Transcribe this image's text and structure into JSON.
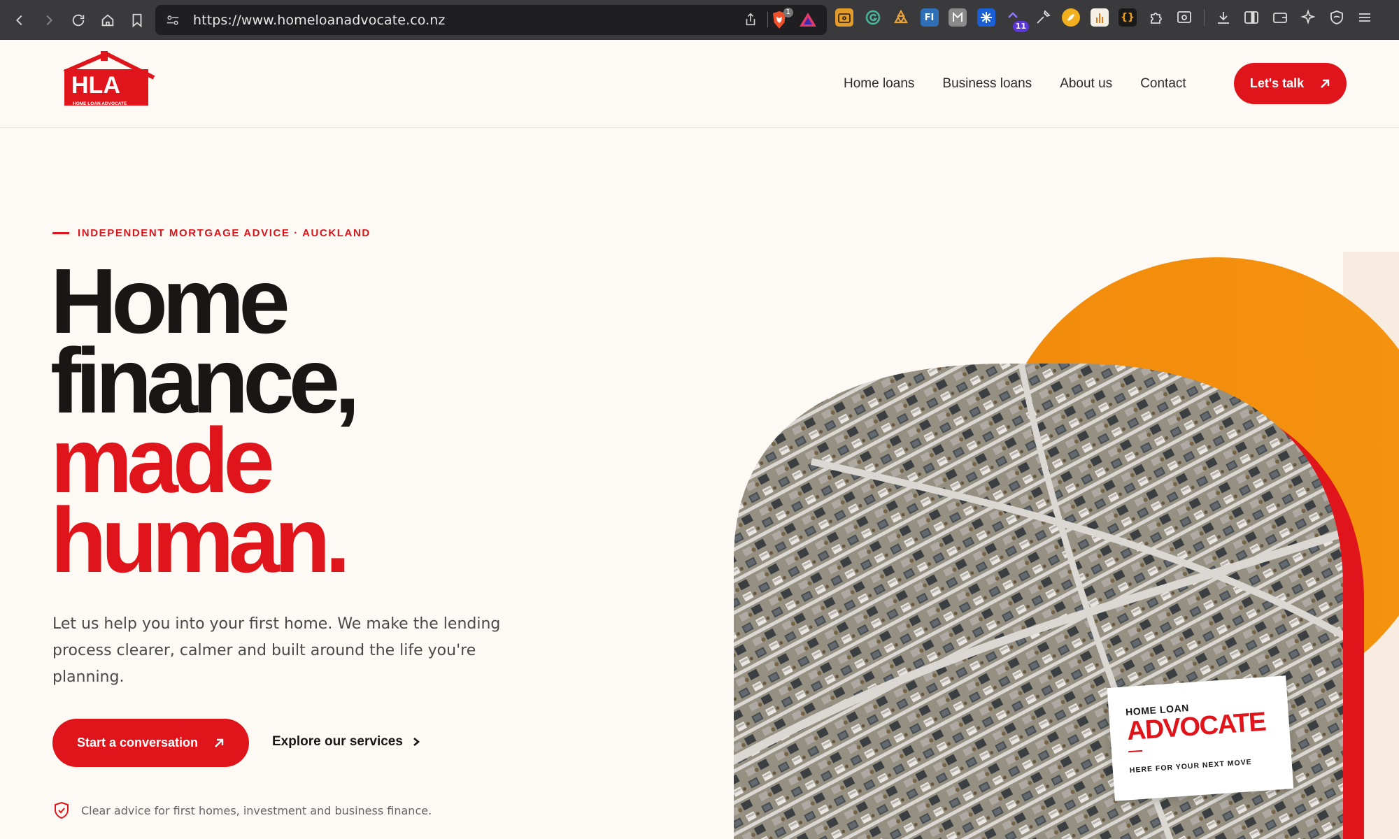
{
  "browser": {
    "url": "https://www.homeloanadvocate.co.nz",
    "shields_count": "1",
    "extension_badge": "11",
    "ext_fi_label": "FI",
    "ext_braces_label": "{}"
  },
  "nav": {
    "logo_letters": "HLA",
    "logo_subtext": "HOME LOAN ADVOCATE",
    "items": [
      {
        "label": "Home loans"
      },
      {
        "label": "Business loans"
      },
      {
        "label": "About us"
      },
      {
        "label": "Contact"
      }
    ],
    "cta_label": "Let's talk"
  },
  "hero": {
    "eyebrow": "INDEPENDENT MORTGAGE ADVICE · AUCKLAND",
    "headline": {
      "line1": "Home",
      "line2": "finance,",
      "line3": "made",
      "line4": "human."
    },
    "lead": "Let us help you into your first home. We make the lending process clearer, calmer and built around the life you're planning.",
    "primary_cta": "Start a conversation",
    "secondary_cta": "Explore our services",
    "trust_note": "Clear advice for first homes, investment and business finance."
  },
  "brand_card": {
    "small": "HOME LOAN",
    "big": "ADVOCATE",
    "tagline": "HERE FOR YOUR NEXT MOVE"
  },
  "colors": {
    "brand_red": "#e0141b",
    "accent_orange": "#f28b0c",
    "page_bg": "#fdf9f4",
    "ink": "#1b1616"
  }
}
